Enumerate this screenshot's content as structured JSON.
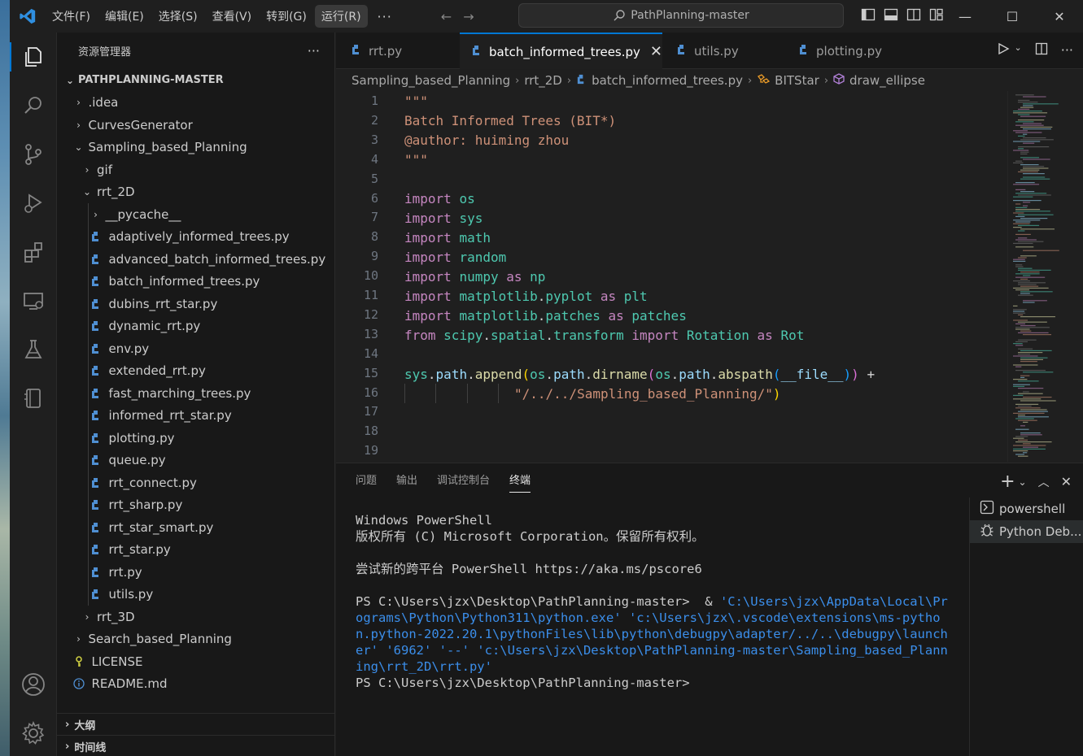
{
  "window": {
    "search_text": "PathPlanning-master",
    "menu": [
      "文件(F)",
      "编辑(E)",
      "选择(S)",
      "查看(V)",
      "转到(G)",
      "运行(R)"
    ],
    "menu_more": "···"
  },
  "explorer": {
    "title": "资源管理器",
    "more": "···",
    "root": "PATHPLANNING-MASTER",
    "items": [
      {
        "label": ".idea",
        "type": "folder"
      },
      {
        "label": "CurvesGenerator",
        "type": "folder"
      },
      {
        "label": "Sampling_based_Planning",
        "type": "folder-open"
      },
      {
        "label": "gif",
        "type": "folder"
      },
      {
        "label": "rrt_2D",
        "type": "folder-open"
      },
      {
        "label": "__pycache__",
        "type": "folder"
      },
      {
        "label": "adaptively_informed_trees.py",
        "type": "py"
      },
      {
        "label": "advanced_batch_informed_trees.py",
        "type": "py"
      },
      {
        "label": "batch_informed_trees.py",
        "type": "py"
      },
      {
        "label": "dubins_rrt_star.py",
        "type": "py"
      },
      {
        "label": "dynamic_rrt.py",
        "type": "py"
      },
      {
        "label": "env.py",
        "type": "py"
      },
      {
        "label": "extended_rrt.py",
        "type": "py"
      },
      {
        "label": "fast_marching_trees.py",
        "type": "py"
      },
      {
        "label": "informed_rrt_star.py",
        "type": "py"
      },
      {
        "label": "plotting.py",
        "type": "py"
      },
      {
        "label": "queue.py",
        "type": "py"
      },
      {
        "label": "rrt_connect.py",
        "type": "py"
      },
      {
        "label": "rrt_sharp.py",
        "type": "py"
      },
      {
        "label": "rrt_star_smart.py",
        "type": "py"
      },
      {
        "label": "rrt_star.py",
        "type": "py"
      },
      {
        "label": "rrt.py",
        "type": "py"
      },
      {
        "label": "utils.py",
        "type": "py"
      },
      {
        "label": "rrt_3D",
        "type": "folder"
      },
      {
        "label": "Search_based_Planning",
        "type": "folder"
      },
      {
        "label": "LICENSE",
        "type": "license"
      },
      {
        "label": "README.md",
        "type": "info"
      }
    ],
    "outline": "大纲",
    "timeline": "时间线"
  },
  "tabs": [
    {
      "label": "rrt.py",
      "active": false
    },
    {
      "label": "batch_informed_trees.py",
      "active": true
    },
    {
      "label": "utils.py",
      "active": false
    },
    {
      "label": "plotting.py",
      "active": false
    }
  ],
  "breadcrumb": [
    "Sampling_based_Planning",
    "rrt_2D",
    "batch_informed_trees.py",
    "BITStar",
    "draw_ellipse"
  ],
  "code": {
    "line_numbers": [
      "1",
      "2",
      "3",
      "4",
      "5",
      "6",
      "7",
      "8",
      "9",
      "10",
      "11",
      "12",
      "13",
      "14",
      "15",
      "16",
      "17",
      "18",
      "19"
    ],
    "l1": "\"\"\"",
    "l2": "Batch Informed Trees (BIT*)",
    "l3": "@author: huiming zhou",
    "l4": "\"\"\"",
    "imports": [
      {
        "kw": "import",
        "mod": "os"
      },
      {
        "kw": "import",
        "mod": "sys"
      },
      {
        "kw": "import",
        "mod": "math"
      },
      {
        "kw": "import",
        "mod": "random"
      }
    ],
    "l10": {
      "kw": "import",
      "mod": "numpy",
      "as": "as",
      "alias": "np"
    },
    "l11": {
      "kw": "import",
      "mod": "matplotlib",
      "dot": ".",
      "sub": "pyplot",
      "as": "as",
      "alias": "plt"
    },
    "l12": {
      "kw": "import",
      "mod": "matplotlib",
      "dot": ".",
      "sub": "patches",
      "as": "as",
      "alias": "patches"
    },
    "l13": {
      "from": "from",
      "mod": "scipy",
      "dot1": ".",
      "sub1": "spatial",
      "dot2": ".",
      "sub2": "transform",
      "kw": "import",
      "cls": "Rotation",
      "as": "as",
      "alias": "Rot"
    },
    "l15": {
      "a": "sys",
      "b": ".",
      "c": "path",
      "d": ".",
      "e": "append",
      "f": "(",
      "g": "os",
      "h": ".",
      "i": "path",
      "j": ".",
      "k": "dirname",
      "l": "(",
      "m": "os",
      "n": ".",
      "o": "path",
      "p": ".",
      "q": "abspath",
      "r": "(",
      "s": "__file__",
      "t": ")",
      "u": ")",
      "v": " +"
    },
    "l16": {
      "str": "\"/../../Sampling_based_Planning/\"",
      "close": ")"
    }
  },
  "panel": {
    "tabs": [
      "问题",
      "输出",
      "调试控制台",
      "终端"
    ],
    "active_tab": "终端",
    "terminal": {
      "line1": "Windows PowerShell",
      "line2": "版权所有 (C) Microsoft Corporation。保留所有权利。",
      "line3": "尝试新的跨平台 PowerShell https://aka.ms/pscore6",
      "prompt1": "PS C:\\Users\\jzx\\Desktop\\PathPlanning-master>  & ",
      "cmd_args": "'C:\\Users\\jzx\\AppData\\Local\\Programs\\Python\\Python311\\python.exe' 'c:\\Users\\jzx\\.vscode\\extensions\\ms-python.python-2022.20.1\\pythonFiles\\lib\\python\\debugpy\\adapter/../..\\debugpy\\launcher' '6962' '--' 'c:\\Users\\jzx\\Desktop\\PathPlanning-master\\Sampling_based_Planning\\rrt_2D\\rrt.py'",
      "prompt2": "PS C:\\Users\\jzx\\Desktop\\PathPlanning-master>"
    },
    "terminals": [
      "powershell",
      "Python Deb..."
    ]
  },
  "colors": {
    "accent": "#0078d4",
    "python_icon": "#4f8fd2"
  }
}
